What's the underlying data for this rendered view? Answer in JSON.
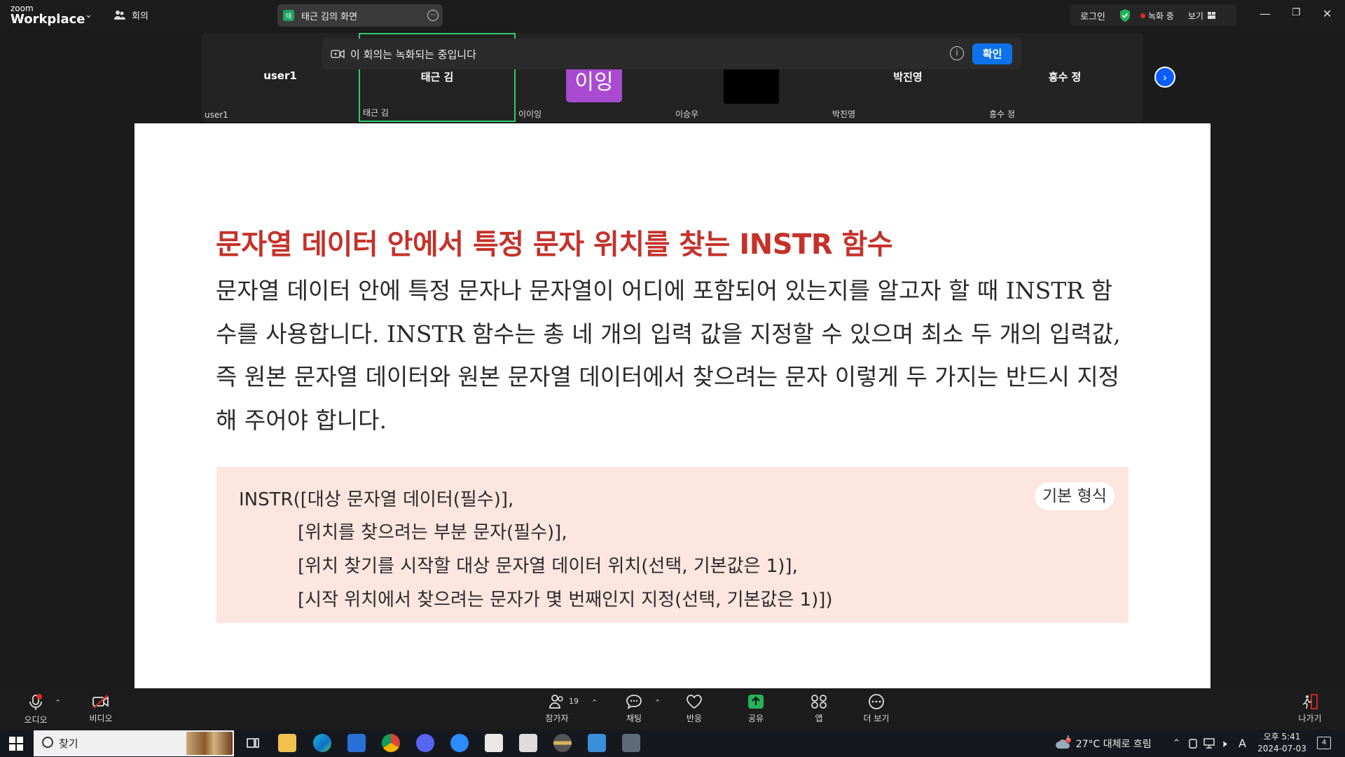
{
  "topbar": {
    "logo_line1": "zoom",
    "logo_line2": "Workplace",
    "meeting_label": "회의",
    "share_tab_badge": "태",
    "share_tab_label": "태근 김의 화면",
    "login_label": "로그인",
    "recording_label": "녹화 중",
    "view_label": "보기"
  },
  "participants": [
    {
      "name": "user1",
      "label": "user1"
    },
    {
      "name": "태근 김",
      "label": "태근 김"
    },
    {
      "name": "이잉",
      "label": "이이잉"
    },
    {
      "name": "",
      "label": "이승우"
    },
    {
      "name": "박진영",
      "label": "박진영"
    },
    {
      "name": "흥수 정",
      "label": "흥수 정"
    }
  ],
  "recording_notice": {
    "text": "이 회의는 녹화되는 중입니다",
    "info_icon": "i",
    "confirm_label": "확인"
  },
  "document": {
    "title": "문자열 데이터 안에서 특정 문자 위치를 찾는 INSTR 함수",
    "paragraph": "문자열 데이터 안에 특정 문자나 문자열이 어디에 포함되어 있는지를 알고자 할 때 INSTR 함수를 사용합니다. INSTR 함수는 총 네 개의 입력 값을 지정할 수 있으며 최소 두 개의 입력값, 즉 원본 문자열 데이터와 원본 문자열 데이터에서 찾으려는 문자 이렇게 두 가지는 반드시 지정해 주어야 합니다.",
    "syntax_lines": [
      "INSTR([대상 문자열 데이터(필수)],",
      "[위치를 찾으려는 부분 문자(필수)],",
      "[위치 찾기를 시작할 대상 문자열 데이터 위치(선택, 기본값은 1)],",
      "[시작 위치에서 찾으려는 문자가 몇 번째인지 지정(선택, 기본값은 1)])"
    ],
    "syntax_tag": "기본 형식"
  },
  "controls": {
    "audio": "오디오",
    "video": "비디오",
    "participants": "참가자",
    "participant_count": "19",
    "chat": "채팅",
    "reactions": "반응",
    "share": "공유",
    "apps": "앱",
    "more": "더 보기",
    "leave": "나가기"
  },
  "taskbar": {
    "search_placeholder": "찾기",
    "weather": "27°C  대체로 흐림",
    "weather_badge": "1",
    "ime": "A",
    "time": "오후 5:41",
    "date": "2024-07-03",
    "notification_count": "4"
  },
  "colors": {
    "accent_blue": "#0e72ed",
    "active_green": "#2ecc71",
    "title_red": "#c4322a",
    "syntax_box": "#fde6e0",
    "recording_red": "#e02828"
  }
}
